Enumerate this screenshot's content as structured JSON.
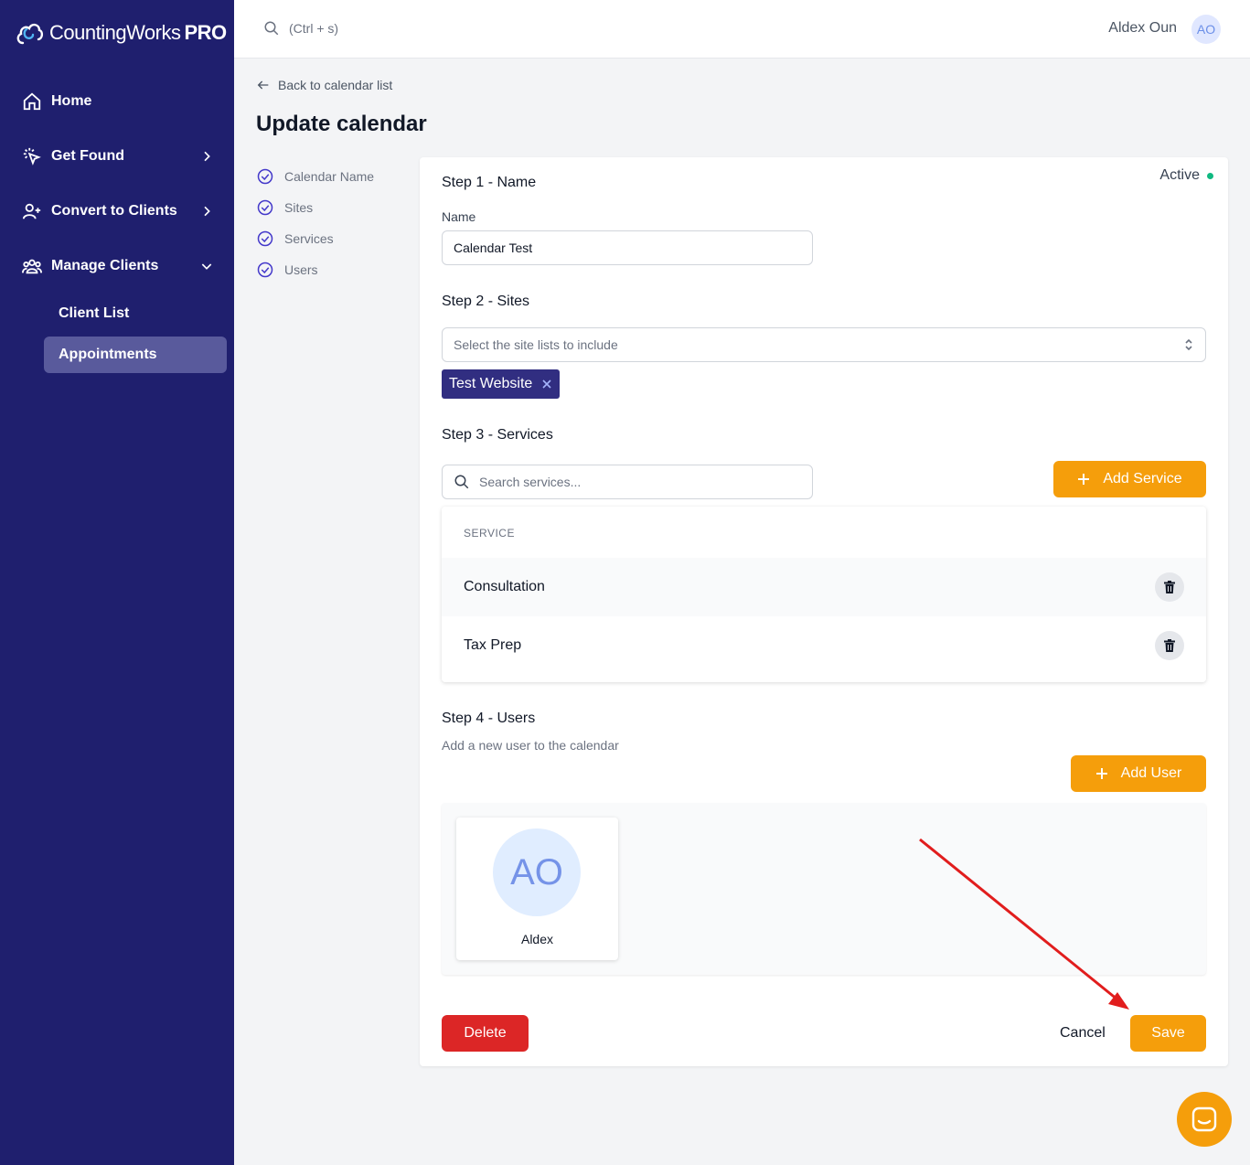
{
  "app": {
    "brand_name": "CountingWorks",
    "brand_suffix": "PRO"
  },
  "sidebar": {
    "items": [
      {
        "label": "Home",
        "icon": "home-icon"
      },
      {
        "label": "Get Found",
        "icon": "cursor-click-icon",
        "chevron": "right"
      },
      {
        "label": "Convert to Clients",
        "icon": "user-plus-icon",
        "chevron": "right"
      },
      {
        "label": "Manage Clients",
        "icon": "users-icon",
        "chevron": "down"
      }
    ],
    "sub_items": [
      {
        "label": "Client List",
        "active": false
      },
      {
        "label": "Appointments",
        "active": true
      }
    ]
  },
  "topbar": {
    "search_hint": "(Ctrl + s)",
    "user_name": "Aldex Oun",
    "user_initials": "AO"
  },
  "main": {
    "back_link": "Back to calendar list",
    "title": "Update calendar",
    "steps_nav": [
      "Calendar Name",
      "Sites",
      "Services",
      "Users"
    ]
  },
  "form": {
    "status": "Active",
    "status_color": "#10b981",
    "step1": {
      "title": "Step 1 - Name",
      "name_label": "Name",
      "name_value": "Calendar Test"
    },
    "step2": {
      "title": "Step 2 - Sites",
      "select_placeholder": "Select the site lists to include",
      "tags": [
        "Test Website"
      ]
    },
    "step3": {
      "title": "Step 3 - Services",
      "search_placeholder": "Search services...",
      "add_button": "Add Service",
      "column_header": "SERVICE",
      "services": [
        "Consultation",
        "Tax Prep"
      ]
    },
    "step4": {
      "title": "Step 4 - Users",
      "subtitle": "Add a new user to the calendar",
      "add_button": "Add User",
      "users": [
        {
          "initials": "AO",
          "name": "Aldex"
        }
      ]
    },
    "actions": {
      "delete": "Delete",
      "cancel": "Cancel",
      "save": "Save"
    }
  },
  "colors": {
    "sidebar_bg": "#1f1f6e",
    "accent_orange": "#f59e0b",
    "danger_red": "#dc2626",
    "tag_bg": "#312e81",
    "annotation_arrow": "#e11d1d"
  }
}
